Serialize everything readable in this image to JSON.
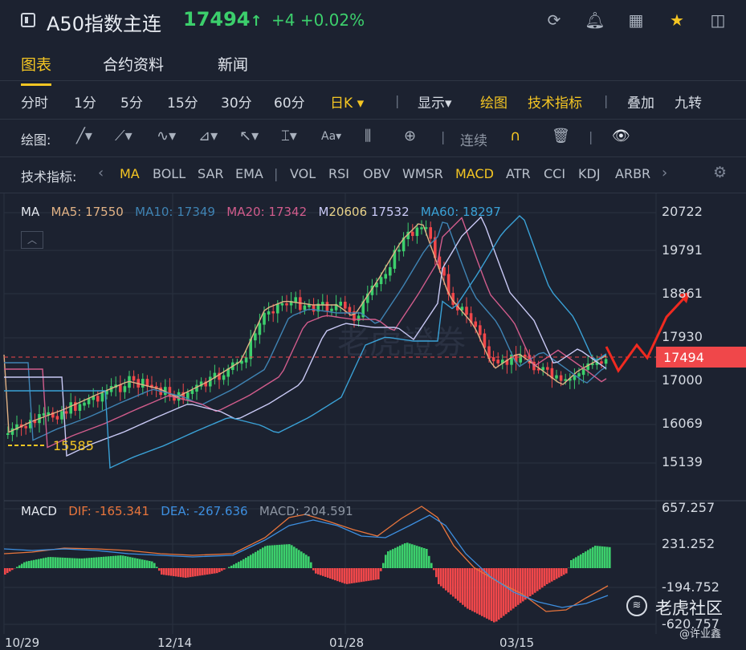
{
  "header": {
    "title": "A50指数主连",
    "price": "17494",
    "arrow": "↑",
    "change": "+4 +0.02%"
  },
  "tabs": [
    "图表",
    "合约资料",
    "新闻"
  ],
  "periods": [
    "分时",
    "1分",
    "5分",
    "15分",
    "30分",
    "60分",
    "日K"
  ],
  "period_dropdown": "▾",
  "display": {
    "show": "显示",
    "draw": "绘图",
    "tech": "技术指标",
    "overlay": "叠加",
    "nine": "九转"
  },
  "draw_bar": {
    "label": "绘图:",
    "link": "连续"
  },
  "indicators": {
    "label": "技术指标:",
    "items": [
      "MA",
      "BOLL",
      "SAR",
      "EMA",
      "|",
      "VOL",
      "RSI",
      "OBV",
      "WMSR",
      "MACD",
      "ATR",
      "CCI",
      "KDJ",
      "ARBR"
    ],
    "active": [
      "MA",
      "MACD"
    ]
  },
  "ma_legend": {
    "ma": "MA",
    "ma5": "MA5: 17550",
    "ma10": "MA10: 17349",
    "ma20": "MA20: 17342",
    "ma30_peak": "20606",
    "ma30": "17532",
    "ma60": "MA60: 18297"
  },
  "price_axis": [
    "20722",
    "19791",
    "18861",
    "17930",
    "17000",
    "16069",
    "15139"
  ],
  "current_price_tag": "17494",
  "low_label": "15585",
  "macd_legend": {
    "macd": "MACD",
    "dif": "DIF: -165.341",
    "dea": "DEA: -267.636",
    "val": "MACD: 204.591"
  },
  "macd_axis": [
    "657.257",
    "231.252",
    "-194.752",
    "-620.757"
  ],
  "dates": [
    "10/29",
    "12/14",
    "01/28",
    "03/15"
  ],
  "watermark": "老虎證券",
  "community": "老虎社区",
  "user": "@许业鑫",
  "colors": {
    "up": "#3ccf6c",
    "down": "#f0474a",
    "ma5": "#e1b285",
    "ma10": "#3f83b3",
    "ma20": "#d15c8c",
    "ma30": "#c9c9f5",
    "ma60": "#3aa1d6",
    "accent": "#f5c623"
  },
  "chart_data": {
    "type": "candlestick",
    "x": [
      "10/29",
      "12/14",
      "01/28",
      "03/15"
    ],
    "price_range": [
      15139,
      20722
    ],
    "current": 17494,
    "macd_range": [
      -620.757,
      657.257
    ]
  }
}
